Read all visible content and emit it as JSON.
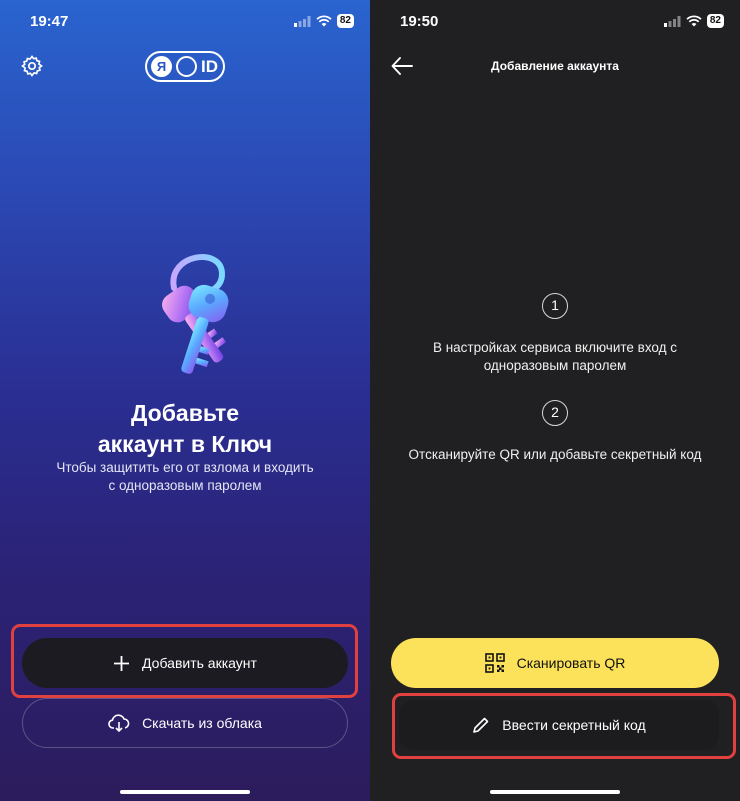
{
  "left": {
    "status": {
      "time": "19:47",
      "battery": "82"
    },
    "logo": {
      "letter": "Я",
      "text": "ID"
    },
    "title": "Добавьте\nаккаунт в Ключ",
    "subtitle": "Чтобы защитить его от взлома и входить\nс одноразовым паролем",
    "add_account_label": "Добавить аккаунт",
    "download_cloud_label": "Скачать из облака",
    "icons": [
      "gear-icon",
      "plus-icon",
      "cloud-download-icon",
      "keys-illustration"
    ]
  },
  "right": {
    "status": {
      "time": "19:50",
      "battery": "82"
    },
    "nav_title": "Добавление аккаунта",
    "steps": [
      {
        "num": "1",
        "text": "В настройках сервиса включите вход с\nодноразовым паролем"
      },
      {
        "num": "2",
        "text": "Отсканируйте QR или добавьте секретный код"
      }
    ],
    "scan_qr_label": "Сканировать QR",
    "enter_code_label": "Ввести секретный код",
    "icons": [
      "back-arrow-icon",
      "qr-icon",
      "pencil-icon"
    ]
  },
  "colors": {
    "highlight": "#e0403e",
    "accent_yellow": "#fce25a",
    "gradient_top": "#2a64cf",
    "gradient_bottom": "#2c1c5c",
    "dark_bg": "#202022"
  }
}
